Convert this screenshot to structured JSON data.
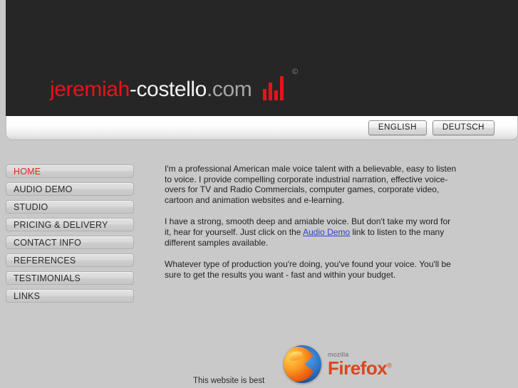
{
  "header": {
    "logo": {
      "part_red": "jeremiah",
      "part_white": "-costello",
      "part_gray": ".com",
      "copyright_symbol": "©",
      "bars_icon": "equalizer-bars-icon"
    },
    "background_color": "#262626",
    "accent_color": "#e8121a"
  },
  "language_bar": {
    "buttons": [
      {
        "label": "ENGLISH"
      },
      {
        "label": "DEUTSCH"
      }
    ]
  },
  "sidebar": {
    "items": [
      {
        "label": "HOME",
        "active": true
      },
      {
        "label": "AUDIO DEMO",
        "active": false
      },
      {
        "label": "STUDIO",
        "active": false
      },
      {
        "label": "PRICING & DELIVERY",
        "active": false
      },
      {
        "label": "CONTACT INFO",
        "active": false
      },
      {
        "label": "REFERENCES",
        "active": false
      },
      {
        "label": "TESTIMONIALS",
        "active": false
      },
      {
        "label": "LINKS",
        "active": false
      }
    ],
    "active_color": "#e8231f"
  },
  "content": {
    "paragraph1": "I'm a professional American male voice talent with a believable, easy to listen to voice.  I provide compelling corporate industrial narration, effective voice-overs for TV and Radio Commercials, computer games, corporate video, cartoon and animation websites and e-learning.",
    "paragraph2_before_link": "I have a strong, smooth deep and amiable voice.  But don't take my word for it, hear for yourself.  Just click on the ",
    "paragraph2_link": "Audio Demo",
    "paragraph2_after_link": " link  to listen to the many different samples available.",
    "paragraph3": "Whatever type of production you're doing, you've found your voice. You'll be sure to get the results you want - fast and within your budget.",
    "link_color": "#2f3fd0"
  },
  "footer": {
    "note": "This website is best",
    "firefox": {
      "mozilla_label": "mozilla",
      "product_label": "Firefox",
      "trademark": "®",
      "globe_icon": "firefox-globe-icon"
    }
  }
}
